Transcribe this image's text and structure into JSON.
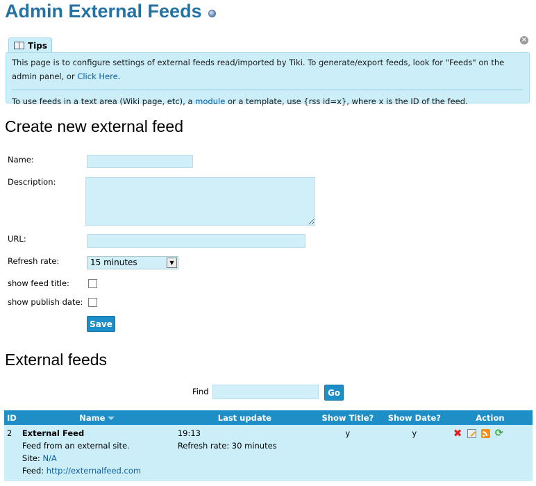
{
  "page": {
    "title": "Admin External Feeds",
    "help_icon": "help-icon"
  },
  "tips": {
    "tab_label": "Tips",
    "tab_icon": "book-icon",
    "close_icon": "close-icon",
    "line1": "This page is to configure settings of external feeds read/imported by Tiki. To generate/export feeds, look for \"Feeds\" on the admin panel, or",
    "line1_link": "Click Here",
    "line1_end": ".",
    "line2_before": "To use feeds in a text area (Wiki page, etc), a",
    "line2_link": "module",
    "line2_after": "or a template, use {rss id=x}, where x is the ID of the feed."
  },
  "create_form": {
    "heading": "Create new external feed",
    "name_label": "Name:",
    "name_value": "",
    "description_label": "Description:",
    "description_value": "",
    "url_label": "URL:",
    "url_value": "",
    "refresh_label": "Refresh rate:",
    "refresh_value": "15 minutes",
    "show_title_label": "show feed title:",
    "show_title_checked": false,
    "show_date_label": "show publish date:",
    "show_date_checked": false,
    "save_label": "Save"
  },
  "feeds": {
    "heading": "External feeds",
    "find_label": "Find",
    "find_value": "",
    "go_label": "Go",
    "columns": {
      "id": "ID",
      "name": "Name",
      "last_update": "Last update",
      "show_title": "Show Title?",
      "show_date": "Show Date?",
      "action": "Action"
    },
    "rows": [
      {
        "id": "2",
        "name": "External Feed",
        "description": "Feed from an external site.",
        "site_label": "Site:",
        "site_value": "N/A",
        "feed_label": "Feed:",
        "feed_value": "http://externalfeed.com",
        "last_update_time": "19:13",
        "refresh_rate_text": "Refresh rate: 30 minutes",
        "show_title": "y",
        "show_date": "y"
      }
    ]
  },
  "colors": {
    "title": "#2472a4",
    "accent": "#1e8ec7",
    "panel_bg": "#cbeef8",
    "link": "#0a5da3"
  }
}
